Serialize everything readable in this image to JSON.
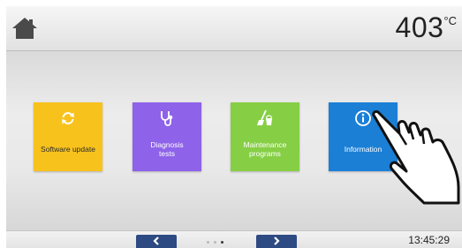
{
  "header": {
    "home_icon": "home-icon",
    "temperature_value": "403",
    "temperature_unit": "°C"
  },
  "tiles": [
    {
      "label": "Software update",
      "icon": "refresh-icon",
      "color": "#f8c21d"
    },
    {
      "label": "Diagnosis\ntests",
      "icon": "stethoscope-icon",
      "color": "#8e62e9"
    },
    {
      "label": "Maintenance\nprograms",
      "icon": "broom-bucket-icon",
      "color": "#86cf45"
    },
    {
      "label": "Information",
      "icon": "info-icon",
      "color": "#1b7fd6"
    }
  ],
  "footer": {
    "prev_icon": "chevron-left-icon",
    "next_icon": "chevron-right-icon",
    "page_count": 3,
    "active_page": 3,
    "time": "13:45:29",
    "nav_color": "#2d4a82"
  },
  "pointer": "hand-pointer-icon"
}
